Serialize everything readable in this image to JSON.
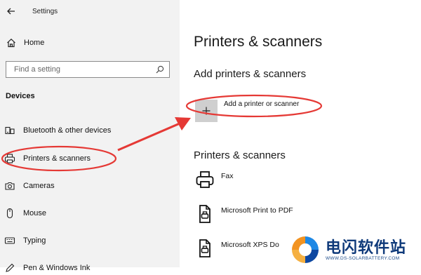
{
  "window": {
    "title": "Settings"
  },
  "sidebar": {
    "home_label": "Home",
    "search_placeholder": "Find a setting",
    "section_title": "Devices",
    "items": [
      {
        "label": "Bluetooth & other devices",
        "icon": "bluetooth-devices-icon"
      },
      {
        "label": "Printers & scanners",
        "icon": "printer-icon"
      },
      {
        "label": "Cameras",
        "icon": "camera-icon"
      },
      {
        "label": "Mouse",
        "icon": "mouse-icon"
      },
      {
        "label": "Typing",
        "icon": "keyboard-icon"
      },
      {
        "label": "Pen & Windows Ink",
        "icon": "pen-icon"
      }
    ]
  },
  "main": {
    "page_title": "Printers & scanners",
    "add_section_title": "Add printers & scanners",
    "add_button_label": "Add a printer or scanner",
    "list_section_title": "Printers & scanners",
    "printers": [
      {
        "name": "Fax",
        "icon": "printer-icon"
      },
      {
        "name": "Microsoft Print to PDF",
        "icon": "document-printer-icon"
      },
      {
        "name": "Microsoft XPS Do",
        "icon": "document-printer-icon"
      }
    ]
  },
  "annotation": {
    "color": "#e53935"
  },
  "watermark": {
    "text_cn": "电闪软件站",
    "url": "WWW.DS-SOLARBATTERY.COM"
  }
}
